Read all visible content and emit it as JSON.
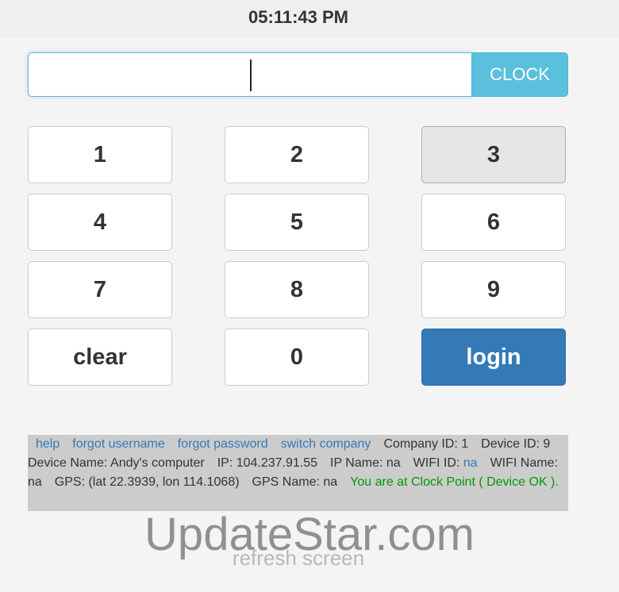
{
  "header": {
    "time": "05:11:43 PM"
  },
  "pin_field": {
    "value": "",
    "placeholder": ""
  },
  "clock_button": {
    "label": "CLOCK"
  },
  "keypad": {
    "keys": [
      "1",
      "2",
      "3",
      "4",
      "5",
      "6",
      "7",
      "8",
      "9",
      "clear",
      "0",
      "login"
    ]
  },
  "info": {
    "links": {
      "help": "help",
      "forgot_username": "forgot username",
      "forgot_password": "forgot password",
      "switch_company": "switch company"
    },
    "company_id": "Company ID: 1",
    "device_id": "Device ID: 9",
    "device_name": "Device Name: Andy's computer",
    "ip": "IP: 104.237.91.55",
    "ip_name": "IP Name: na",
    "wifi_id_label": "WIFI ID:",
    "wifi_id_value": "na",
    "wifi_name": "WIFI Name: na",
    "gps": "GPS: (lat 22.3939, lon 114.1068)",
    "gps_name": "GPS Name: na",
    "status": "You are at Clock Point ( Device OK )."
  },
  "footer": {
    "refresh_label": "refresh screen"
  },
  "watermark": "UpdateStar.com",
  "colors": {
    "accent_info": "#5bc0de",
    "primary": "#337ab7",
    "success": "#009900",
    "link": "#337ab7"
  }
}
